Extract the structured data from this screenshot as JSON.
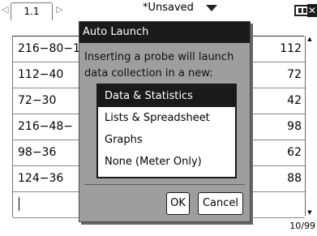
{
  "tabs": {
    "active_label": "1.1",
    "document_title": "*Unsaved"
  },
  "table": {
    "rows": [
      {
        "expr": "216−80−1",
        "value": "112"
      },
      {
        "expr": "112−40",
        "value": "72"
      },
      {
        "expr": "72−30",
        "value": "42"
      },
      {
        "expr": "216−48−",
        "value": "98"
      },
      {
        "expr": "98−36",
        "value": "62"
      },
      {
        "expr": "124−36",
        "value": "88"
      }
    ]
  },
  "status": {
    "position": "10/99"
  },
  "dialog": {
    "title": "Auto Launch",
    "message": "Inserting a probe will launch data collection in a new:",
    "options": [
      {
        "label": "Data & Statistics",
        "selected": true
      },
      {
        "label": "Lists & Spreadsheet",
        "selected": false
      },
      {
        "label": "Graphs",
        "selected": false
      },
      {
        "label": "None (Meter Only)",
        "selected": false
      }
    ],
    "ok_label": "OK",
    "cancel_label": "Cancel"
  }
}
